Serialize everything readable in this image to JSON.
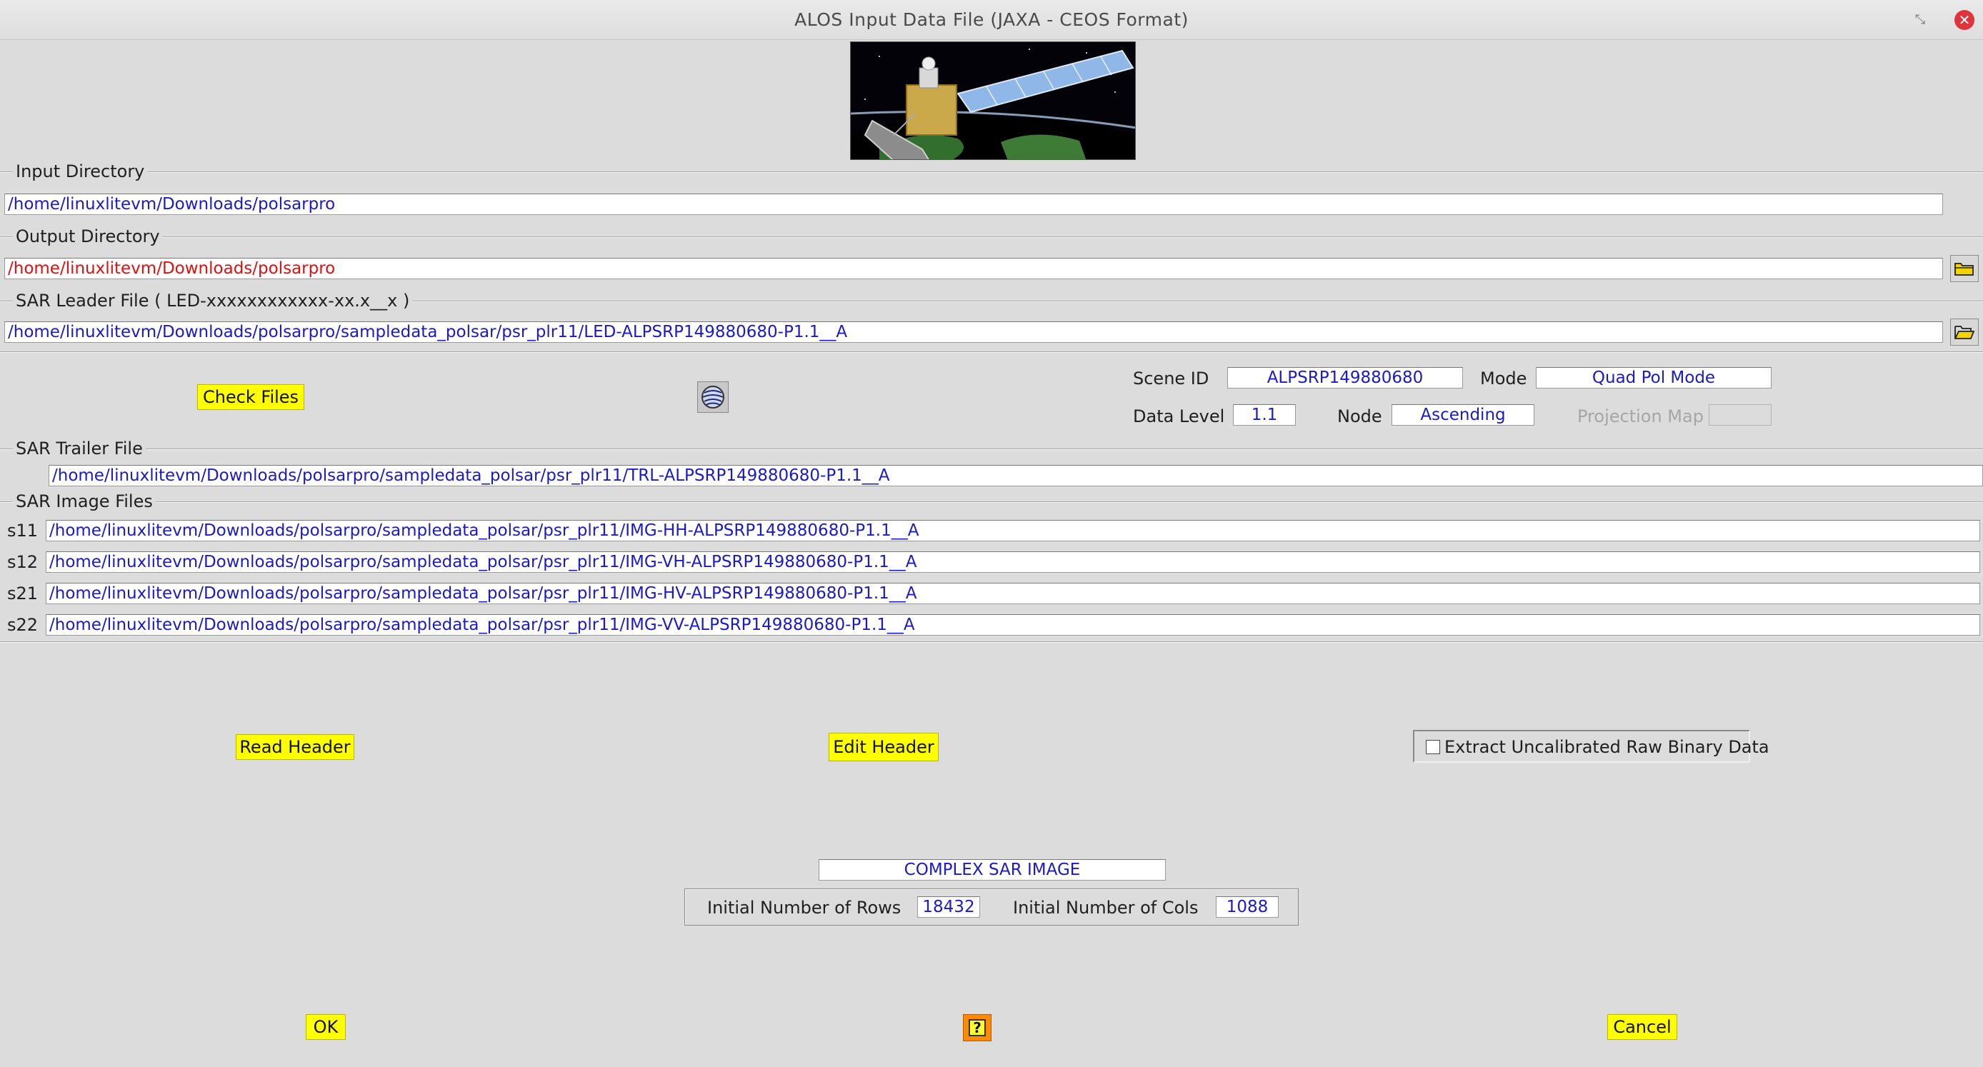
{
  "window": {
    "title": "ALOS Input Data File (JAXA - CEOS Format)",
    "restore_glyph": "⤡",
    "close_glyph": "✕"
  },
  "input_directory": {
    "label": "Input Directory",
    "value": "/home/linuxlitevm/Downloads/polsarpro"
  },
  "output_directory": {
    "label": "Output Directory",
    "value": "/home/linuxlitevm/Downloads/polsarpro"
  },
  "leader_file": {
    "label": "SAR Leader File  ( LED-xxxxxxxxxxxx-xx.x__x )",
    "value": "/home/linuxlitevm/Downloads/polsarpro/sampledata_polsar/psr_plr11/LED-ALPSRP149880680-P1.1__A"
  },
  "check_files_label": "Check Files",
  "scene": {
    "scene_id_label": "Scene ID",
    "scene_id": "ALPSRP149880680",
    "mode_label": "Mode",
    "mode": "Quad Pol Mode",
    "data_level_label": "Data Level",
    "data_level": "1.1",
    "node_label": "Node",
    "node": "Ascending",
    "projection_label": "Projection Map",
    "projection": ""
  },
  "trailer_file": {
    "label": "SAR Trailer File",
    "value": "/home/linuxlitevm/Downloads/polsarpro/sampledata_polsar/psr_plr11/TRL-ALPSRP149880680-P1.1__A"
  },
  "image_files": {
    "label": "SAR Image Files",
    "rows": [
      {
        "name": "s11",
        "value": "/home/linuxlitevm/Downloads/polsarpro/sampledata_polsar/psr_plr11/IMG-HH-ALPSRP149880680-P1.1__A"
      },
      {
        "name": "s12",
        "value": "/home/linuxlitevm/Downloads/polsarpro/sampledata_polsar/psr_plr11/IMG-VH-ALPSRP149880680-P1.1__A"
      },
      {
        "name": "s21",
        "value": "/home/linuxlitevm/Downloads/polsarpro/sampledata_polsar/psr_plr11/IMG-HV-ALPSRP149880680-P1.1__A"
      },
      {
        "name": "s22",
        "value": "/home/linuxlitevm/Downloads/polsarpro/sampledata_polsar/psr_plr11/IMG-VV-ALPSRP149880680-P1.1__A"
      }
    ]
  },
  "buttons": {
    "read_header": "Read Header",
    "edit_header": "Edit Header",
    "ok": "OK",
    "cancel": "Cancel",
    "help_glyph": "?"
  },
  "extract_raw": {
    "label": "Extract Uncalibrated Raw Binary Data",
    "checked": false
  },
  "image_info": {
    "type": "COMPLEX SAR IMAGE",
    "rows_label": "Initial Number of Rows",
    "rows": "18432",
    "cols_label": "Initial Number of Cols",
    "cols": "1088"
  },
  "colors": {
    "button_yellow": "#ffff00",
    "value_blue": "#1a1ac8",
    "output_red": "#e01010",
    "help_orange": "#ff8a00"
  },
  "icons": {
    "browse": "folder-open-icon",
    "help": "help-icon",
    "status": "globe-status-icon",
    "banner": "alos-satellite-image"
  }
}
